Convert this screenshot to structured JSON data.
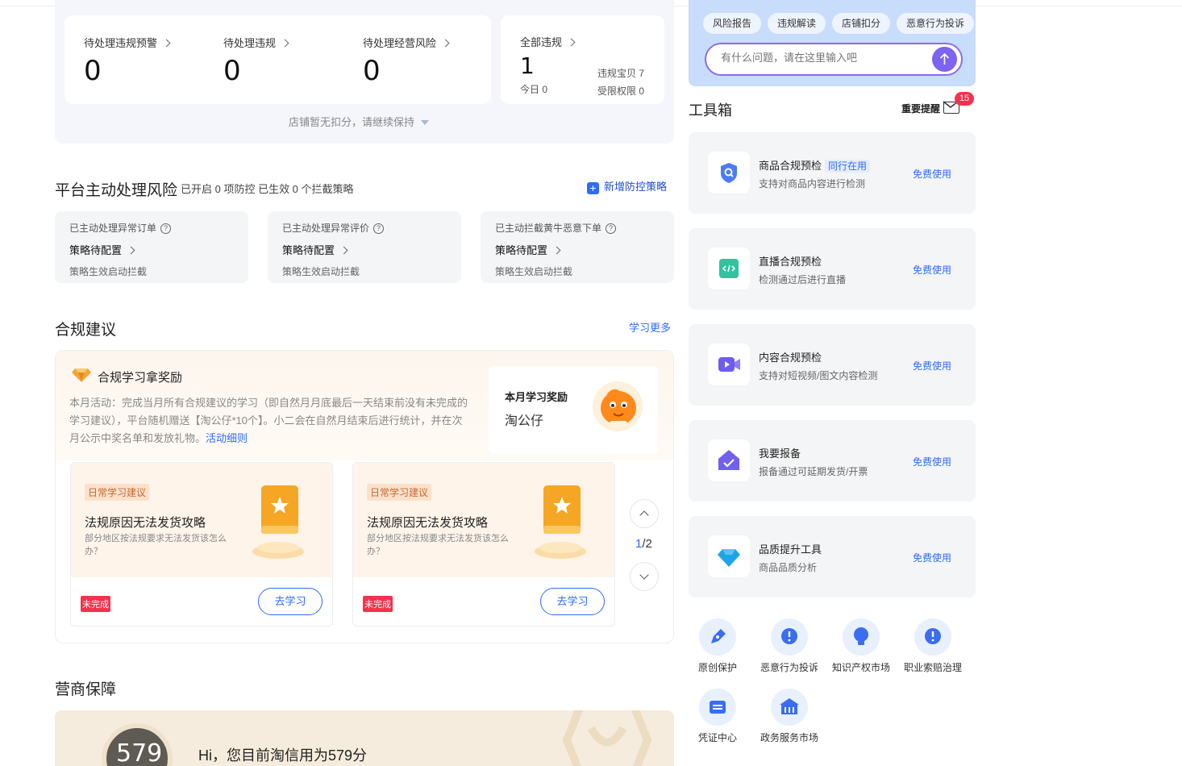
{
  "summary": {
    "items": [
      {
        "label": "待处理违规预警",
        "value": "0"
      },
      {
        "label": "待处理违规",
        "value": "0"
      },
      {
        "label": "待处理经营风险",
        "value": "0"
      }
    ],
    "all": {
      "label": "全部违规",
      "value": "1",
      "today": "今日 0",
      "baby": "违规宝贝 7",
      "limited": "受限权限 0"
    },
    "note": "店铺暂无扣分，请继续保持"
  },
  "platform": {
    "title": "平台主动处理风险",
    "desc": "已开启 0 项防控 已生效 0 个拦截策略",
    "add": "新增防控策略",
    "cards": [
      {
        "title": "已主动处理异常订单",
        "status": "策略待配置",
        "sub": "策略生效启动拦截"
      },
      {
        "title": "已主动处理异常评价",
        "status": "策略待配置",
        "sub": "策略生效启动拦截"
      },
      {
        "title": "已主动拦截黄牛恶意下单",
        "status": "策略待配置",
        "sub": "策略生效启动拦截"
      }
    ]
  },
  "compliance": {
    "title": "合规建议",
    "more": "学习更多",
    "reward_title": "合规学习拿奖励",
    "reward_desc": "本月活动：完成当月所有合规建议的学习（即自然月月底最后一天结束前没有未完成的学习建议），平台随机赠送【淘公仔*10个】。小二会在自然月结束后进行统计，并在次月公示中奖名单和发放礼物。",
    "reward_link": "活动细则",
    "month_label": "本月学习奖励",
    "month_prize": "淘公仔",
    "cards": [
      {
        "tag": "日常学习建议",
        "title": "法规原因无法发货攻略",
        "desc": "部分地区按法规要求无法发货该怎么办？",
        "status": "未完成",
        "btn": "去学习"
      },
      {
        "tag": "日常学习建议",
        "title": "法规原因无法发货攻略",
        "desc": "部分地区按法规要求无法发货该怎么办？",
        "status": "未完成",
        "btn": "去学习"
      }
    ],
    "page_current": "1",
    "page_total": "/2"
  },
  "guarantee": {
    "title": "营商保障",
    "score": "579",
    "greeting": "Hi，您目前淘信用为579分"
  },
  "ai": {
    "pills": [
      "风险报告",
      "违规解读",
      "店铺扣分",
      "恶意行为投诉"
    ],
    "placeholder": "有什么问题，请在这里输入吧"
  },
  "toolbox": {
    "title": "工具箱",
    "reminder": "重要提醒",
    "badge": "15",
    "tools": [
      {
        "title": "商品合规预检",
        "tag": "同行在用",
        "sub": "支持对商品内容进行检测",
        "action": "免费使用"
      },
      {
        "title": "直播合规预检",
        "tag": "",
        "sub": "检测通过后进行直播",
        "action": "免费使用"
      },
      {
        "title": "内容合规预检",
        "tag": "",
        "sub": "支持对短视频/图文内容检测",
        "action": "免费使用"
      },
      {
        "title": "我要报备",
        "tag": "",
        "sub": "报备通过可延期发货/开票",
        "action": "免费使用"
      },
      {
        "title": "品质提升工具",
        "tag": "",
        "sub": "商品品质分析",
        "action": "免费使用"
      }
    ],
    "quick": [
      "原创保护",
      "恶意行为投诉",
      "知识产权市场",
      "职业索赔治理",
      "凭证中心",
      "政务服务市场"
    ]
  },
  "colors": {
    "accent": "#2f6bff",
    "purple": "#8b6cf3",
    "danger": "#f5314c"
  }
}
